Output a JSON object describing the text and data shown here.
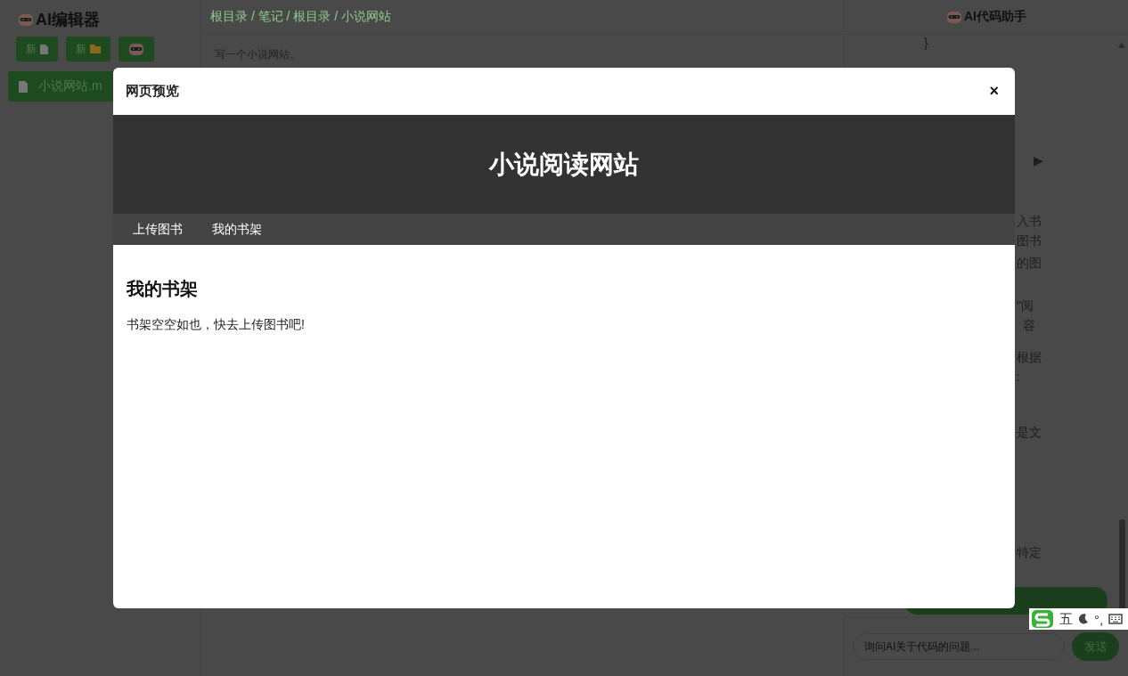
{
  "sidebar": {
    "title": "AI编辑器",
    "buttons": [
      {
        "kind": "new-file",
        "label": "新"
      },
      {
        "kind": "new-folder",
        "label": "新"
      },
      {
        "kind": "robot"
      }
    ],
    "files": [
      {
        "name": "小说网站.m",
        "selected": true
      }
    ]
  },
  "editor": {
    "breadcrumb": "根目录 / 笔记 / 根目录 / 小说网站",
    "content": "写一个小说网站。"
  },
  "assistant": {
    "title": "AI代码助手",
    "fragments": [
      "}",
      "▶",
      "入书",
      "图书",
      "的图",
      "\"阅",
      "容",
      "根据",
      ":",
      "是文",
      "特定"
    ],
    "input": {
      "placeholder": "询问AI关于代码的问题..."
    },
    "send_button": "发送"
  },
  "modal": {
    "title": "网页预览",
    "close": "×",
    "preview": {
      "site_title": "小说阅读网站",
      "nav": [
        {
          "label": "上传图书"
        },
        {
          "label": "我的书架"
        }
      ],
      "heading": "我的书架",
      "message": "书架空空如也，快去上传图书吧!"
    }
  },
  "ime_bar": {
    "mode": "五",
    "punctuation": "°,"
  }
}
